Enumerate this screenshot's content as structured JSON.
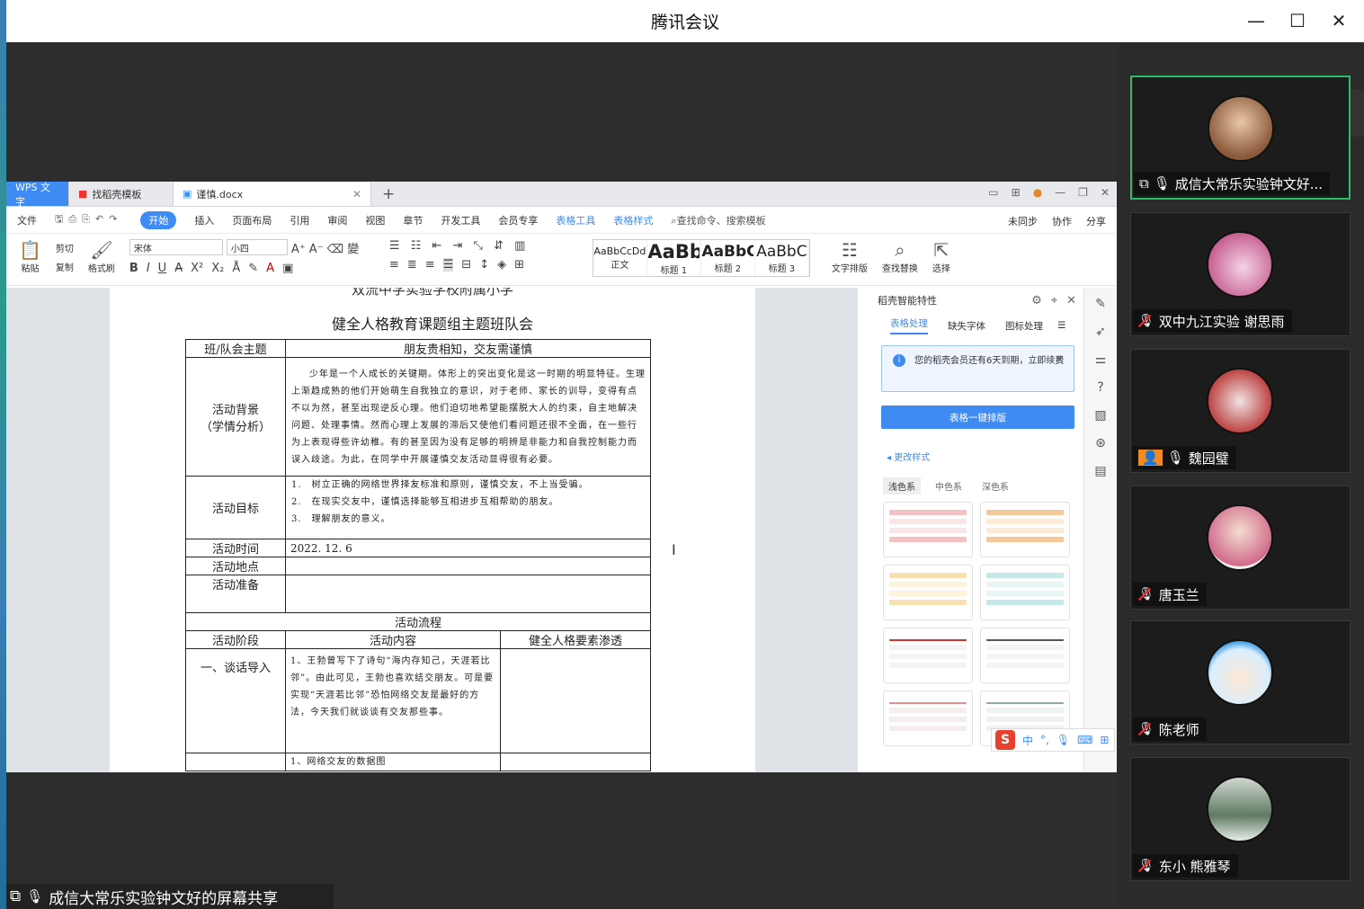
{
  "window": {
    "title": "腾讯会议",
    "minimize": "—",
    "maximize": "☐",
    "close": "✕"
  },
  "wps": {
    "tabs": [
      {
        "label": "WPS 文字"
      },
      {
        "label": "找稻壳模板"
      },
      {
        "label": "谨慎.docx"
      }
    ],
    "tab_add": "+",
    "menu": [
      "文件",
      "开始",
      "插入",
      "页面布局",
      "引用",
      "审阅",
      "视图",
      "章节",
      "开发工具",
      "会员专享",
      "表格工具",
      "表格样式",
      "查找命令、搜索模板"
    ],
    "menu_right": [
      "未同步",
      "协作",
      "分享"
    ],
    "ribbon": {
      "paste": "粘贴",
      "cut": "剪切",
      "copy": "复制",
      "format_painter": "格式刷",
      "font": "宋体",
      "size": "小四",
      "styles": [
        {
          "preview": "AaBbCcDd",
          "name": "正文"
        },
        {
          "preview": "AaBb",
          "name": "标题 1"
        },
        {
          "preview": "AaBbC",
          "name": "标题 2"
        },
        {
          "preview": "AaBbC",
          "name": "标题 3"
        }
      ],
      "text_layout": "文字排版",
      "find_replace": "查找替换",
      "select": "选择"
    },
    "document": {
      "cut_title": "双流中学实验学校附属小学",
      "title": "健全人格教育课题组主题班队会",
      "theme_label": "班/队会主题",
      "theme_value": "朋友贵相知，交友需谨慎",
      "bg_label_1": "活动背景",
      "bg_label_2": "（学情分析）",
      "bg_text": "少年是一个人成长的关键期。体形上的突出变化是这一时期的明显特征。生理上渐趋成熟的他们开始萌生自我独立的意识，对于老师、家长的训导，变得有点不以为然，甚至出现逆反心理。他们迫切地希望能摆脱大人的约束，自主地解决问题、处理事情。然而心理上发展的滞后又使他们看问题还很不全面，在一些行为上表现得些许幼稚。有的甚至因为没有足够的明辨是非能力和自我控制能力而误入歧途。为此，在同学中开展谨慎交友活动显得很有必要。",
      "goal_label": "活动目标",
      "goals": [
        "1.　树立正确的网络世界择友标准和原则，谨慎交友，不上当受骗。",
        "2.　在现实交友中，谨慎选择能够互相进步互相帮助的朋友。",
        "3.　理解朋友的意义。"
      ],
      "time_label": "活动时间",
      "time_value": "2022. 12. 6",
      "place_label": "活动地点",
      "prep_label": "活动准备",
      "flow_label": "活动流程",
      "col_stage": "活动阶段",
      "col_content": "活动内容",
      "col_element": "健全人格要素渗透",
      "stage1": "一、谈话导入",
      "stage1_text": "1、王勃曾写下了诗句“海内存知己，天涯若比邻”。由此可见，王勃也喜欢结交朋友。可是要实现“天涯若比邻”恐怕网络交友是最好的方法，今天我们就谈谈有交友那些事。",
      "row_next": "1、网络交友的数据图"
    },
    "panel": {
      "header": "稻壳智能特性",
      "tabs": [
        "表格处理",
        "缺失字体",
        "图标处理"
      ],
      "notice": "您的稻壳会员还有6天到期，立即续费",
      "button": "表格一键排版",
      "section": "更改样式",
      "chips": [
        "浅色系",
        "中色系",
        "深色系"
      ]
    },
    "ime": {
      "logo": "S",
      "lang": "中"
    }
  },
  "share_label": "成信大常乐实验钟文好的屏幕共享",
  "participants": [
    {
      "name": "成信大常乐实验钟文好..."
    },
    {
      "name": "双中九江实验 谢思雨"
    },
    {
      "name": "魏园璧"
    },
    {
      "name": "唐玉兰"
    },
    {
      "name": "陈老师"
    },
    {
      "name": "东小 熊雅琴"
    }
  ]
}
